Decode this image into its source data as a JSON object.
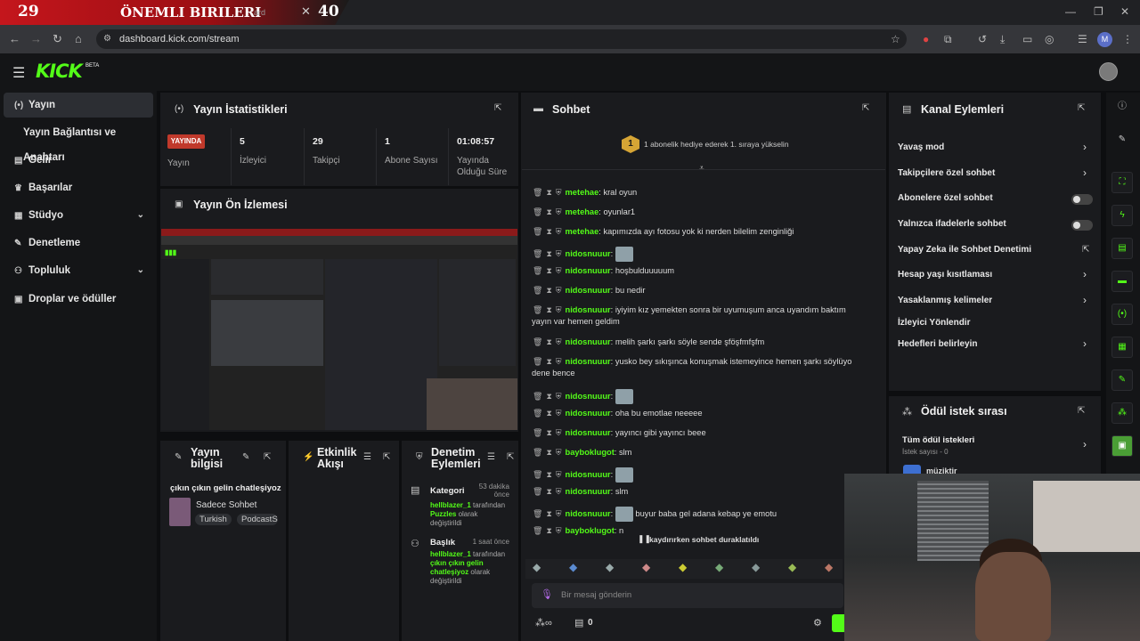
{
  "overlay": {
    "left_num": "29",
    "title": "ÖNEMLI BIRILERI",
    "tab_fragment": "ard",
    "right_num": "40"
  },
  "browser": {
    "url": "dashboard.kick.com/stream",
    "profile_initial": "M"
  },
  "app": {
    "logo": "KICK",
    "beta": "BETA"
  },
  "sidebar": {
    "items": [
      {
        "label": "Yayın",
        "icon": "broadcast-icon"
      },
      {
        "label": "Yayın Bağlantısı ve Anahtarı"
      },
      {
        "label": "Gelir",
        "icon": "revenue-icon"
      },
      {
        "label": "Başarılar",
        "icon": "trophy-icon"
      },
      {
        "label": "Stüdyo",
        "icon": "studio-icon"
      },
      {
        "label": "Denetleme",
        "icon": "wrench-icon"
      },
      {
        "label": "Topluluk",
        "icon": "community-icon"
      },
      {
        "label": "Droplar ve ödüller",
        "icon": "gift-icon"
      }
    ]
  },
  "stats": {
    "title": "Yayın İstatistikleri",
    "badge": "YAYINDA",
    "badge_label": "Yayın",
    "cells": [
      {
        "value": "5",
        "label": "İzleyici"
      },
      {
        "value": "29",
        "label": "Takipçi"
      },
      {
        "value": "1",
        "label": "Abone Sayısı"
      },
      {
        "value": "01:08:57",
        "label": "Yayında Olduğu Süre"
      }
    ]
  },
  "preview": {
    "title": "Yayın Ön İzlemesi"
  },
  "info": {
    "title": "Yayın bilgisi",
    "stream_title": "çıkın çıkın gelin chatleşiyoz",
    "category": "Sadece Sohbet",
    "tags": [
      "Turkish",
      "PodcastS"
    ]
  },
  "activity": {
    "title": "Etkinlik Akışı"
  },
  "moderation": {
    "title": "Denetim Eylemleri",
    "items": [
      {
        "label": "Kategori",
        "time": "53 dakika önce",
        "user": "hellblazer_1",
        "text1": " tarafından ",
        "value": "Puzzles",
        "text2": " olarak değiştirildi"
      },
      {
        "label": "Başlık",
        "time": "1 saat önce",
        "user": "hellblazer_1",
        "text1": " tarafından ",
        "value": "çıkın çıkın gelin chatleşiyoz",
        "text2": " olarak değiştirildi"
      }
    ]
  },
  "chat": {
    "title": "Sohbet",
    "gift_rank": "1",
    "gift_text": "1 abonelik hediye ederek 1. sıraya yükselin",
    "messages": [
      {
        "user": "metehae",
        "text": "kral oyun",
        "emote": false
      },
      {
        "user": "metehae",
        "text": "oyunlar1",
        "emote": false
      },
      {
        "user": "metehae",
        "text": "kapımızda ayı fotosu yok ki nerden bilelim zenginliği",
        "emote": false
      },
      {
        "user": "nidosnuuur",
        "text": "",
        "emote": true
      },
      {
        "user": "nidosnuuur",
        "text": "hoşbulduuuuum",
        "emote": false
      },
      {
        "user": "nidosnuuur",
        "text": "bu nedir",
        "emote": false
      },
      {
        "user": "nidosnuuur",
        "text": "iyiyim kız yemekten sonra bir uyumuşum anca uyandım baktım",
        "cont": "yayın var hemen geldim",
        "emote": false
      },
      {
        "user": "nidosnuuur",
        "text": "melih şarkı şarkı söyle sende şföşfmfşfm",
        "emote": false
      },
      {
        "user": "nidosnuuur",
        "text": "yusko bey sıkışınca konuşmak istemeyince hemen şarkı söylüyo",
        "cont": "dene bence",
        "emote": false
      },
      {
        "user": "nidosnuuur",
        "text": "",
        "emote": true
      },
      {
        "user": "nidosnuuur",
        "text": "oha bu emotlae neeeee",
        "emote": false
      },
      {
        "user": "nidosnuuur",
        "text": "yayıncı gibi yayıncı beee",
        "emote": false
      },
      {
        "user": "bayboklugot",
        "text": "slm",
        "emote": false
      },
      {
        "user": "nidosnuuur",
        "text": "",
        "emote": true
      },
      {
        "user": "nidosnuuur",
        "text": "slm",
        "emote": false
      },
      {
        "user": "nidosnuuur",
        "text": "buyur baba gel adana kebap ye emotu",
        "emote": true
      },
      {
        "user": "bayboklugot",
        "text": "n",
        "emote": false
      }
    ],
    "paused": "kaydırırken sohbet duraklatıldı",
    "input_placeholder": "Bir mesaj gönderin",
    "footer_count": "0"
  },
  "channel_actions": {
    "title": "Kanal Eylemleri",
    "items": [
      {
        "label": "Yavaş mod",
        "control": "chevron"
      },
      {
        "label": "Takipçilere özel sohbet",
        "control": "chevron"
      },
      {
        "label": "Abonelere özel sohbet",
        "control": "toggle"
      },
      {
        "label": "Yalnızca ifadelerle sohbet",
        "control": "toggle"
      },
      {
        "label": "Yapay Zeka ile Sohbet Denetimi",
        "control": "external"
      },
      {
        "label": "Hesap yaşı kısıtlaması",
        "control": "chevron"
      },
      {
        "label": "Yasaklanmış kelimeler",
        "control": "chevron"
      },
      {
        "label": "İzleyici Yönlendir",
        "control": "none"
      },
      {
        "label": "Hedefleri belirleyin",
        "control": "chevron"
      }
    ]
  },
  "rewards": {
    "title": "Ödül istek sırası",
    "all_label": "Tüm ödül istekleri",
    "count_label": "İstek sayısı - 0",
    "item": "müziktir"
  }
}
